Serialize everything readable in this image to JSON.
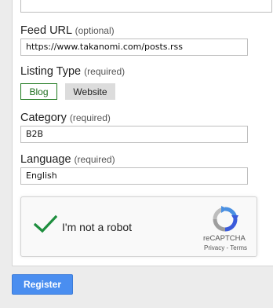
{
  "form": {
    "feed_url": {
      "label": "Feed URL",
      "qualifier": "(optional)",
      "value": "https://www.takanomi.com/posts.rss"
    },
    "listing_type": {
      "label": "Listing Type",
      "qualifier": "(required)",
      "options": [
        "Blog",
        "Website"
      ],
      "selected": "Blog"
    },
    "category": {
      "label": "Category",
      "qualifier": "(required)",
      "value": "B2B"
    },
    "language": {
      "label": "Language",
      "qualifier": "(required)",
      "value": "English"
    }
  },
  "captcha": {
    "label": "I'm not a robot",
    "checked": true,
    "brand": "reCAPTCHA",
    "privacy": "Privacy",
    "separator": "-",
    "terms": "Terms",
    "check_color": "#1e8e3e"
  },
  "submit": {
    "label": "Register",
    "color": "#4a8ef0"
  }
}
